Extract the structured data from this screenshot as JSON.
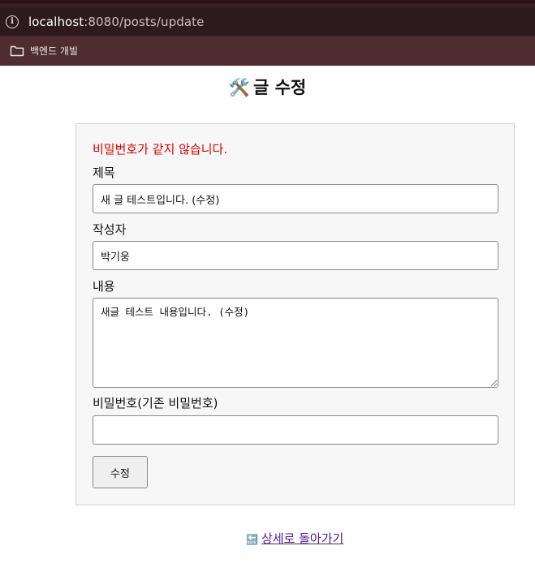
{
  "browser": {
    "url_host": "localhost",
    "url_rest": ":8080/posts/update",
    "bookmark_folder": "백엔드 개빌"
  },
  "page": {
    "title_icon": "🛠️",
    "title": "글 수정"
  },
  "form": {
    "error": "비밀번호가 같지 않습니다.",
    "title_label": "제목",
    "title_value": "새 글 테스트입니다. (수정)",
    "author_label": "작성자",
    "author_value": "박기웅",
    "content_label": "내용",
    "content_value": "새글 테스트 내용입니다. (수정)",
    "password_label": "비밀번호(기존 비밀번호)",
    "password_value": "",
    "submit_label": "수정"
  },
  "footer": {
    "back_icon": "🔙",
    "back_label": "상세로 돌아가기"
  },
  "colors": {
    "error": "#e00000",
    "link": "#4b1c96",
    "chrome_dark": "#3a1f24",
    "bookmarks_bar": "#4e2c31"
  }
}
